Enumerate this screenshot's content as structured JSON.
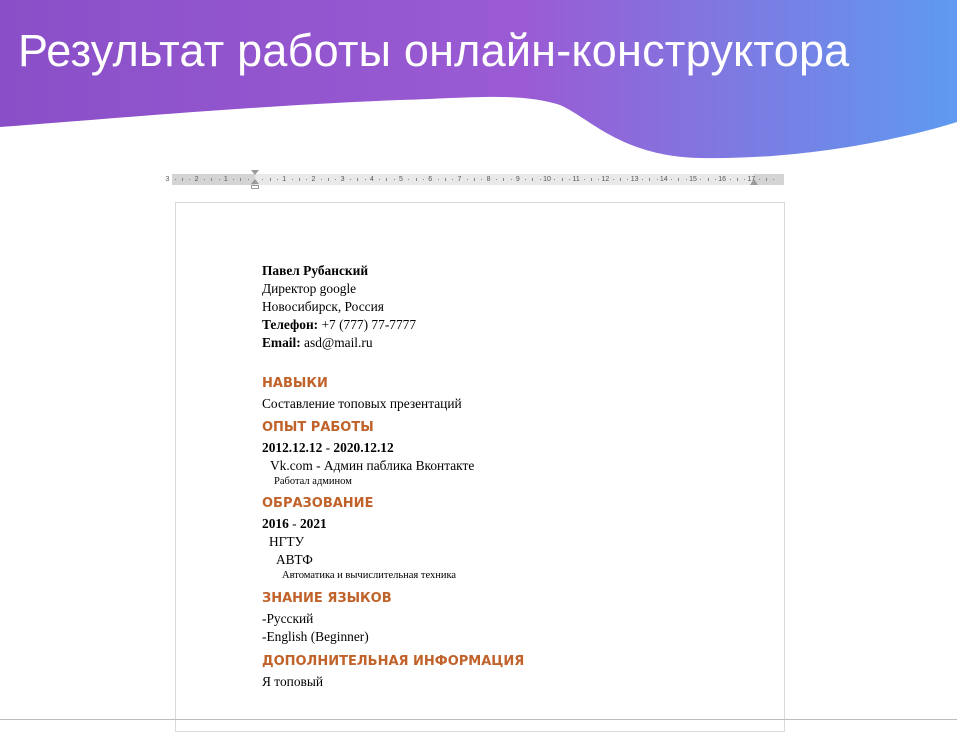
{
  "slide": {
    "title": "Результат работы онлайн-конструктора",
    "gradient": {
      "from": "#8a4fc8",
      "mid": "#9b5fd6",
      "to": "#5f9af0"
    }
  },
  "ruler": {
    "labels": [
      "3",
      "2",
      "1",
      "1",
      "2",
      "3",
      "4",
      "5",
      "6",
      "7",
      "8",
      "9",
      "10",
      "11",
      "12",
      "13",
      "14",
      "15",
      "16",
      "17"
    ]
  },
  "resume": {
    "name": "Павел Рубанский",
    "position": "Директор google",
    "location": "Новосибирск, Россия",
    "phone_label": "Телефон:",
    "phone_value": "+7 (777) 77-7777",
    "email_label": "Email:",
    "email_value": "asd@mail.ru",
    "skills": {
      "heading": "НАВЫКИ",
      "text": "Составление топовых презентаций"
    },
    "experience": {
      "heading": "ОПЫТ РАБОТЫ",
      "date_start": "2012.12.12",
      "date_sep": " - ",
      "date_end": "2020.12.12",
      "company": "Vk.com - Админ паблика Вконтакте",
      "duty": "Работал админом"
    },
    "education": {
      "heading": "ОБРАЗОВАНИЕ",
      "year_start": "2016",
      "year_sep": " - ",
      "year_end": "2021",
      "university": "НГТУ",
      "faculty": "АВТФ",
      "speciality": "Автоматика и вычислительная техника"
    },
    "languages": {
      "heading": "ЗНАНИЕ ЯЗЫКОВ",
      "items": [
        "-Русский",
        "-English (Beginner)"
      ]
    },
    "additional": {
      "heading": "ДОПОЛНИТЕЛЬНАЯ ИНФОРМАЦИЯ",
      "text": "Я топовый"
    },
    "heading_color": "#c0622a"
  }
}
